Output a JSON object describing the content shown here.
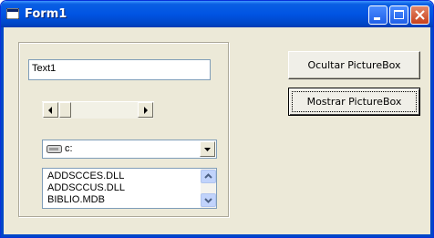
{
  "window": {
    "title": "Form1"
  },
  "titlebar_buttons": {
    "minimize": "minimize-icon",
    "maximize": "maximize-icon",
    "close": "close-icon"
  },
  "form": {
    "textbox_value": "Text1",
    "drive": {
      "value": "c:",
      "icon": "drive-icon"
    },
    "filelist": {
      "items": [
        "ADDSCCES.DLL",
        "ADDSCCUS.DLL",
        "BIBLIO.MDB"
      ]
    },
    "hide_button": "Ocultar PictureBox",
    "show_button": "Mostrar PictureBox"
  },
  "colors": {
    "titlebar": "#0054e3",
    "window_bg": "#ece9d8",
    "close": "#c8401c"
  }
}
